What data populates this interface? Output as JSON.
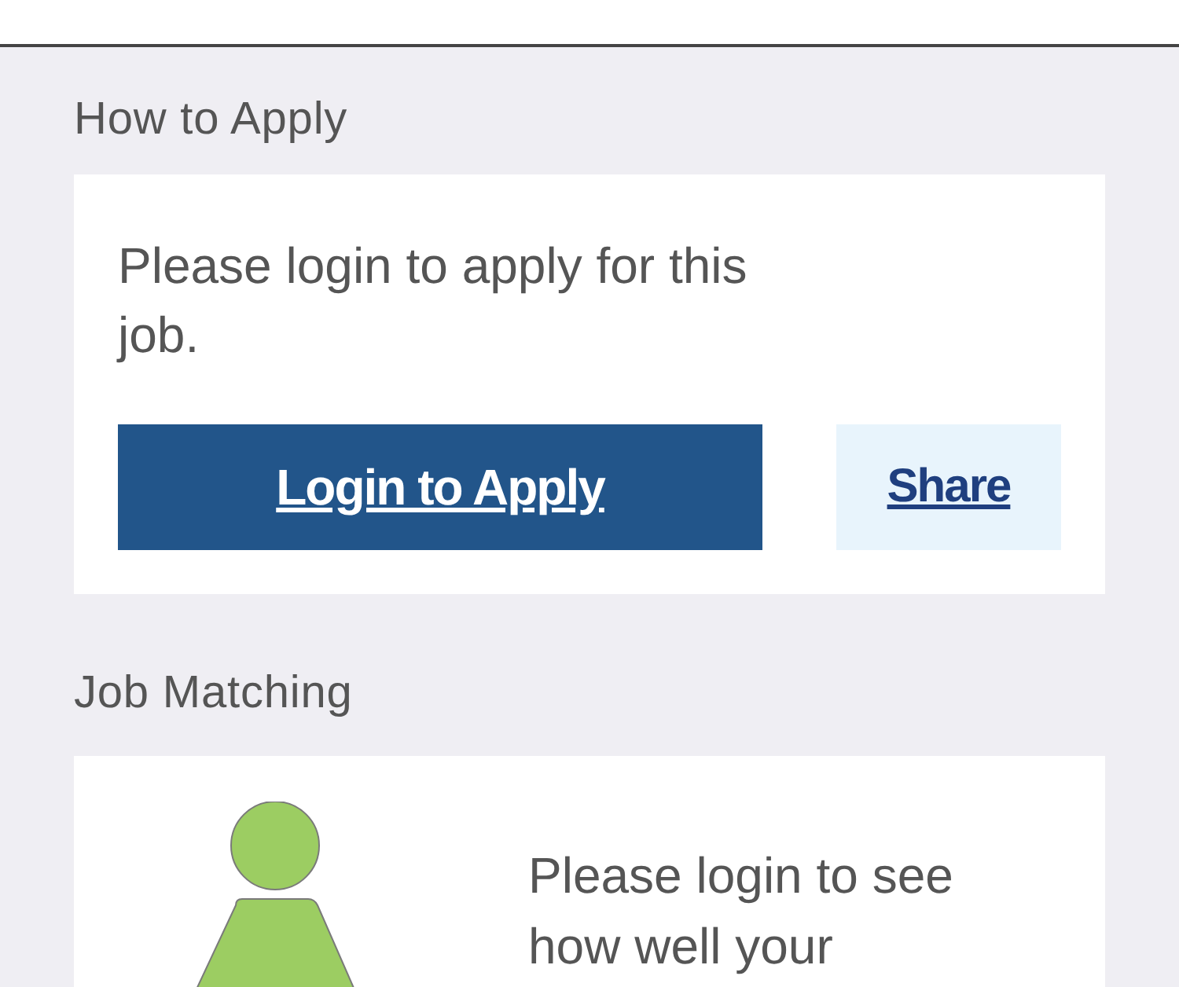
{
  "sections": [
    {
      "kind": "apply",
      "title": "How to Apply",
      "message": "Please login to apply for this job.",
      "primary_button": "Login to Apply",
      "secondary_button": "Share"
    },
    {
      "kind": "matching",
      "title": "Job Matching",
      "message": "Please login to see how well your"
    }
  ]
}
